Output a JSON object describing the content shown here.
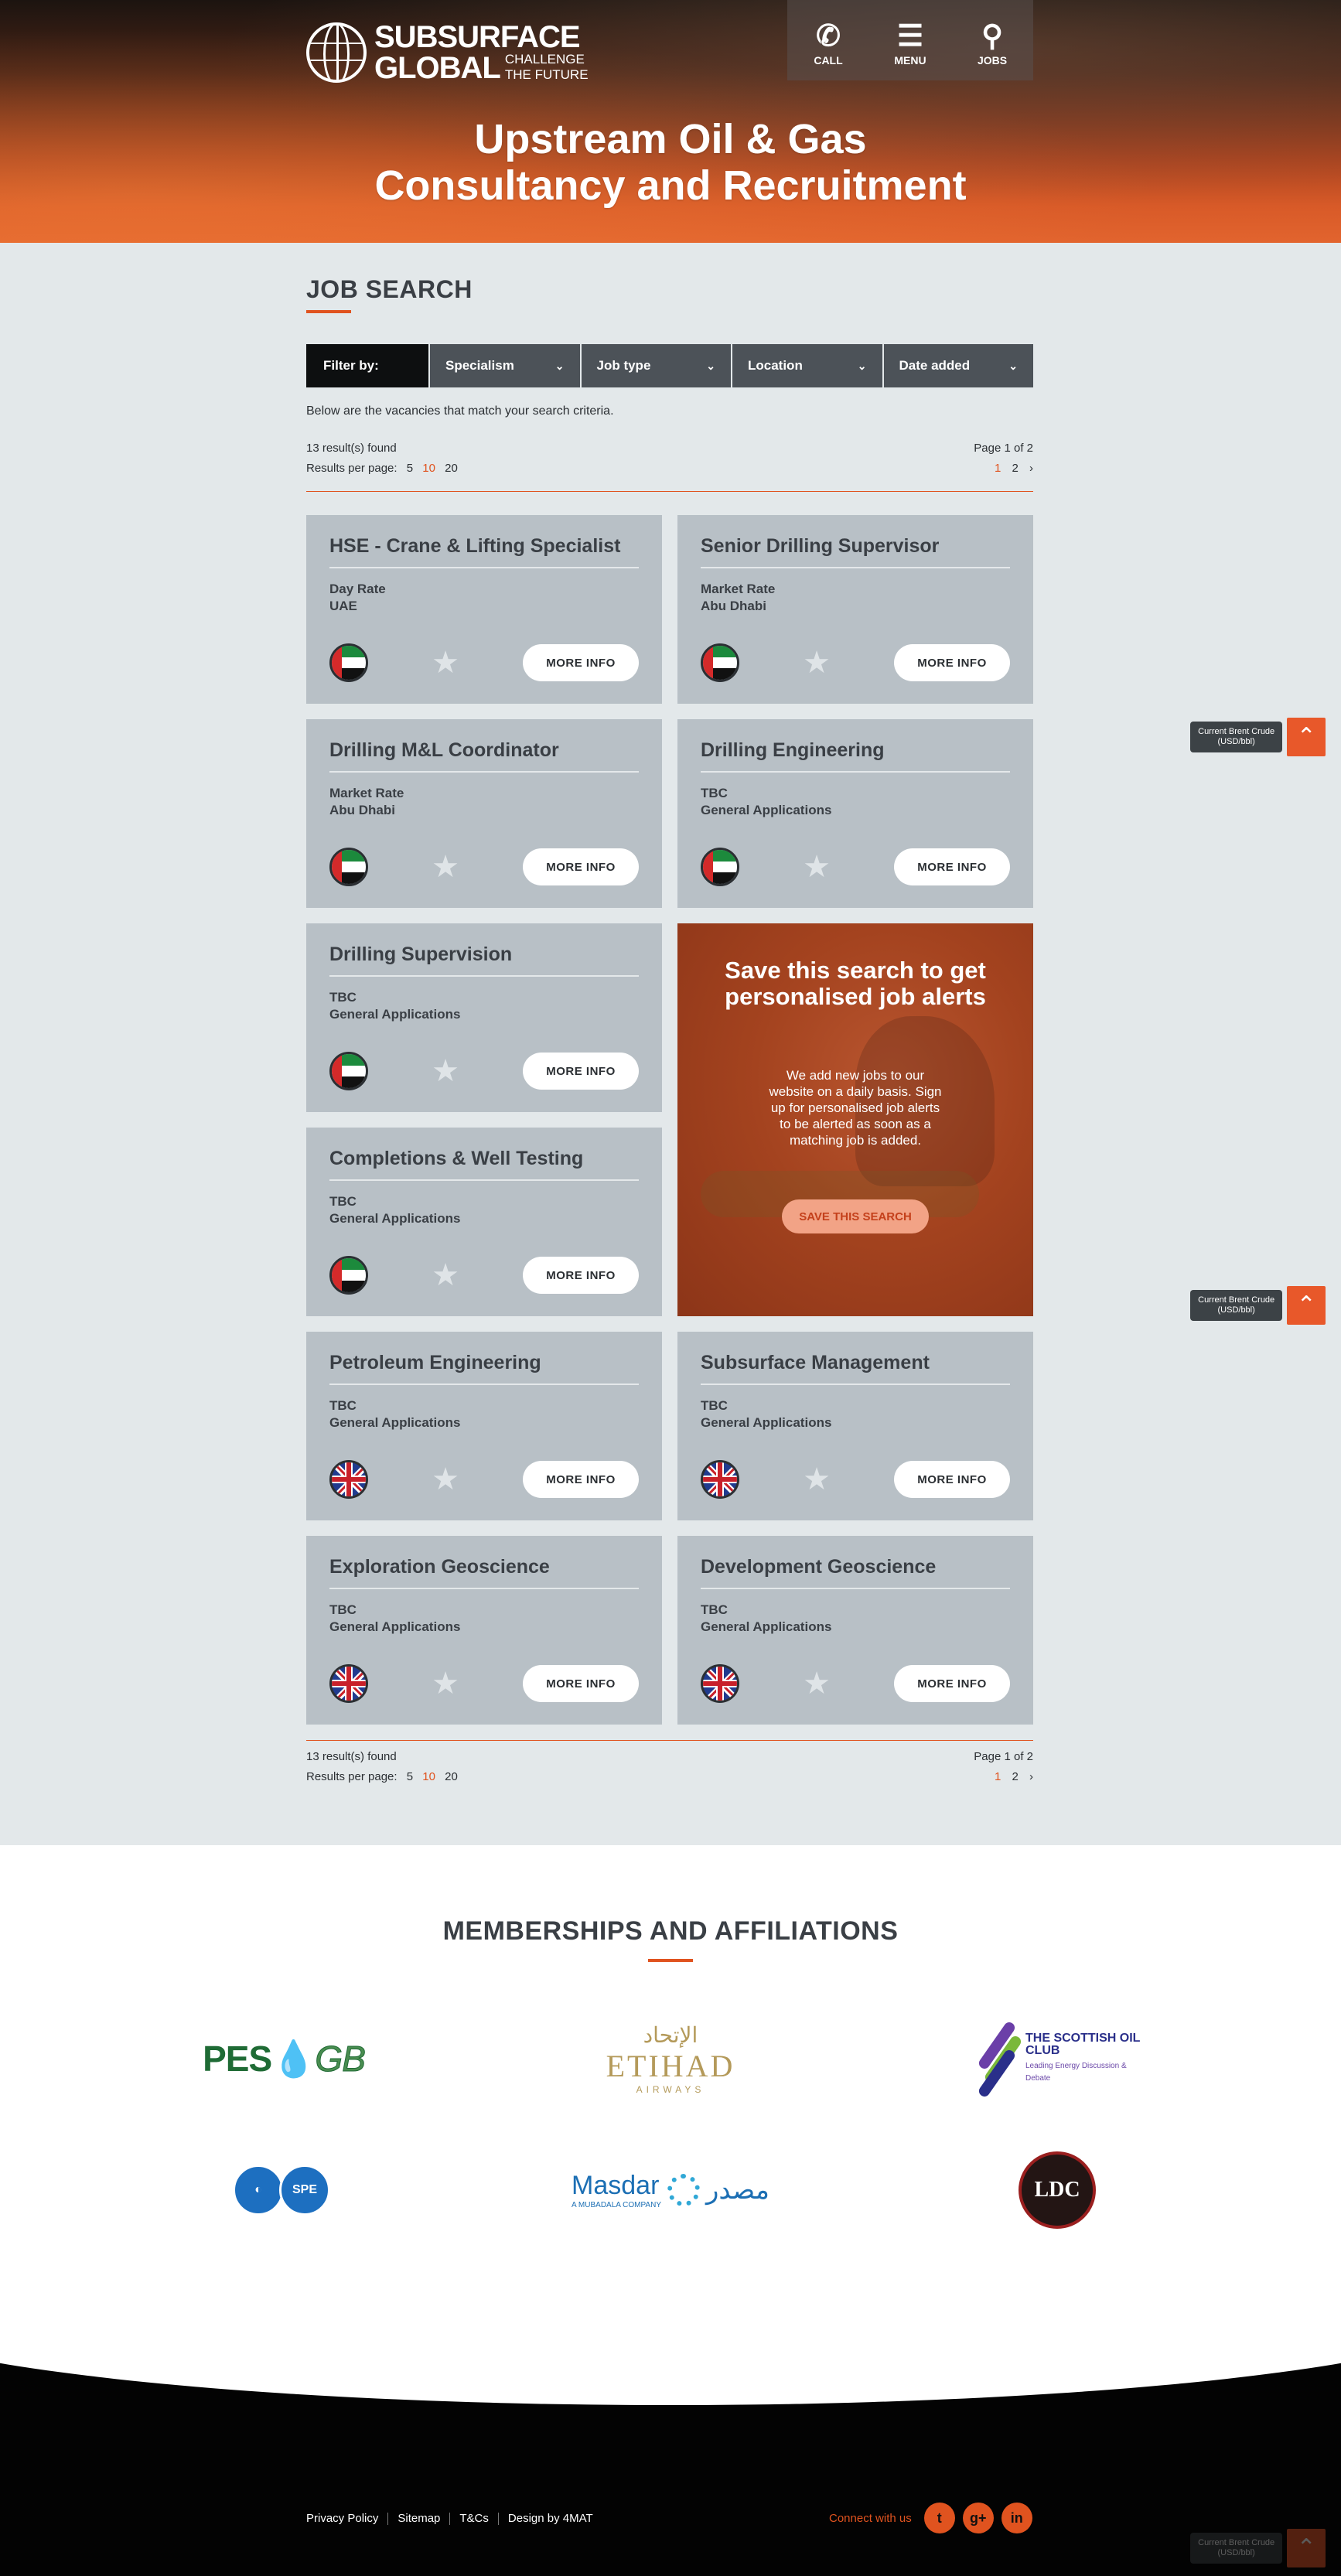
{
  "header": {
    "logo_main": "SUBSURFACE",
    "logo_main2": "GLOBAL",
    "logo_sub1": "CHALLENGE",
    "logo_sub2": "THE FUTURE",
    "nav": [
      {
        "label": "CALL",
        "icon": "phone-icon"
      },
      {
        "label": "MENU",
        "icon": "menu-icon"
      },
      {
        "label": "JOBS",
        "icon": "search-icon"
      }
    ],
    "hero_line1": "Upstream Oil & Gas",
    "hero_line2": "Consultancy and Recruitment"
  },
  "search": {
    "title": "JOB SEARCH",
    "filter_label": "Filter by:",
    "filters": [
      "Specialism",
      "Job type",
      "Location",
      "Date added"
    ],
    "intro": "Below are the vacancies that match your search criteria.",
    "results_found": "13 result(s) found",
    "per_page_label": "Results per page:",
    "per_page_options": [
      "5",
      "10",
      "20"
    ],
    "per_page_selected": "10",
    "page_info": "Page 1 of 2",
    "pages": [
      "1",
      "2"
    ],
    "next": "›"
  },
  "jobs": [
    {
      "title": "HSE - Crane & Lifting Specialist",
      "rate": "Day Rate",
      "location": "UAE",
      "flag": "uae"
    },
    {
      "title": "Senior Drilling Supervisor",
      "rate": "Market Rate",
      "location": "Abu Dhabi",
      "flag": "uae"
    },
    {
      "title": "Drilling M&L Coordinator",
      "rate": "Market Rate",
      "location": "Abu Dhabi",
      "flag": "uae"
    },
    {
      "title": "Drilling Engineering",
      "rate": "TBC",
      "location": "General Applications",
      "flag": "uae"
    },
    {
      "title": "Drilling Supervision",
      "rate": "TBC",
      "location": "General Applications",
      "flag": "uae"
    },
    {
      "title": "Completions & Well Testing",
      "rate": "TBC",
      "location": "General Applications",
      "flag": "uae"
    },
    {
      "title": "Petroleum Engineering",
      "rate": "TBC",
      "location": "General Applications",
      "flag": "uk"
    },
    {
      "title": "Subsurface Management",
      "rate": "TBC",
      "location": "General Applications",
      "flag": "uk"
    },
    {
      "title": "Exploration Geoscience",
      "rate": "TBC",
      "location": "General Applications",
      "flag": "uk"
    },
    {
      "title": "Development Geoscience",
      "rate": "TBC",
      "location": "General Applications",
      "flag": "uk"
    }
  ],
  "more_info_label": "MORE INFO",
  "promo": {
    "title": "Save this search to get personalised job alerts",
    "text": "We add new jobs to our website on a daily basis. Sign up for personalised job alerts to be alerted as soon as a matching job is added.",
    "button": "SAVE THIS SEARCH"
  },
  "brent": {
    "label": "Current Brent Crude (USD/bbl)"
  },
  "memberships": {
    "title": "MEMBERSHIPS AND AFFILIATIONS",
    "logos": [
      {
        "name": "PESGB",
        "text": "PES",
        "text2": "GB"
      },
      {
        "name": "Etihad Airways",
        "arabic": "الإتحاد",
        "text": "ETIHAD",
        "text2": "AIRWAYS"
      },
      {
        "name": "The Scottish Oil Club",
        "text": "THE SCOTTISH OIL CLUB",
        "text2": "Leading Energy Discussion & Debate"
      },
      {
        "name": "SPE International",
        "text": "SPE"
      },
      {
        "name": "Masdar",
        "text": "Masdar",
        "text2": "A MUBADALA COMPANY",
        "arabic": "مصدر"
      },
      {
        "name": "LDC",
        "text": "LDC"
      }
    ]
  },
  "footer": {
    "links": [
      "Privacy Policy",
      "Sitemap",
      "T&Cs",
      "Design by 4MAT"
    ],
    "connect_label": "Connect with us",
    "social": [
      {
        "icon": "twitter-icon",
        "glyph": "t"
      },
      {
        "icon": "google-plus-icon",
        "glyph": "g+"
      },
      {
        "icon": "linkedin-icon",
        "glyph": "in"
      }
    ]
  },
  "colors": {
    "accent": "#e0531f",
    "card": "#b8c0c6",
    "page_bg": "#e3e8ea",
    "filter_bg": "#4c5258"
  }
}
